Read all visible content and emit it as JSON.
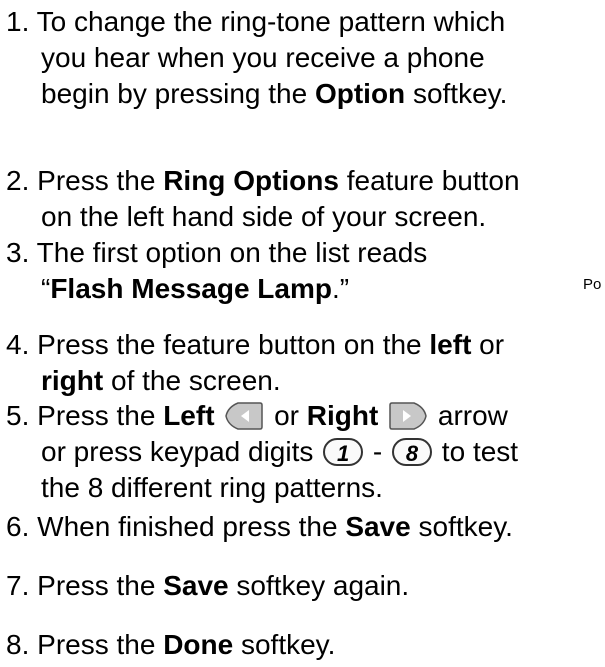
{
  "steps": [
    {
      "number": "1.",
      "line1": "To change the ring-tone pattern which",
      "line2": "you hear when you receive a phone",
      "line3_pre": "begin by pressing the ",
      "line3_bold": "Option",
      "line3_post": " softkey."
    },
    {
      "number": "2.",
      "line1_pre": "Press the ",
      "line1_bold": "Ring Options",
      "line1_post": " feature button",
      "line2": "on the left hand side of your screen."
    },
    {
      "number": "3.",
      "line1": "The first option on the list reads",
      "line2_pre": "“",
      "line2_bold": "Flash Message Lamp",
      "line2_post": ".”"
    },
    {
      "number": "4.",
      "line1_pre": "Press the feature button on the ",
      "line1_bold": "left",
      "line1_post": " or",
      "line2_bold": "right",
      "line2_post": " of the screen."
    },
    {
      "number": "5.",
      "line1_pre": "Press the ",
      "line1_bold1": "Left",
      "line1_mid": " or ",
      "line1_bold2": "Right",
      "line1_post": " arrow",
      "line2_pre": "or press keypad digits ",
      "line2_dash": " - ",
      "line2_post": " to test",
      "key_first": "1",
      "key_last": "8",
      "line3": "the 8 different ring patterns."
    },
    {
      "number": "6.",
      "text_pre": "When finished press the ",
      "text_bold": "Save",
      "text_post": " softkey."
    },
    {
      "number": "7.",
      "text_pre": "Press the ",
      "text_bold": "Save",
      "text_post": " softkey again."
    },
    {
      "number": "8.",
      "text_pre": "Press the ",
      "text_bold": "Done",
      "text_post": " softkey."
    }
  ],
  "side_note": "Po",
  "icons": {
    "left_arrow": "left-arrow-key-icon",
    "right_arrow": "right-arrow-key-icon"
  },
  "colors": {
    "arrow_key_fill": "#c8c8c8",
    "arrow_key_border": "#555555",
    "arrow_glyph": "#ffffff"
  }
}
